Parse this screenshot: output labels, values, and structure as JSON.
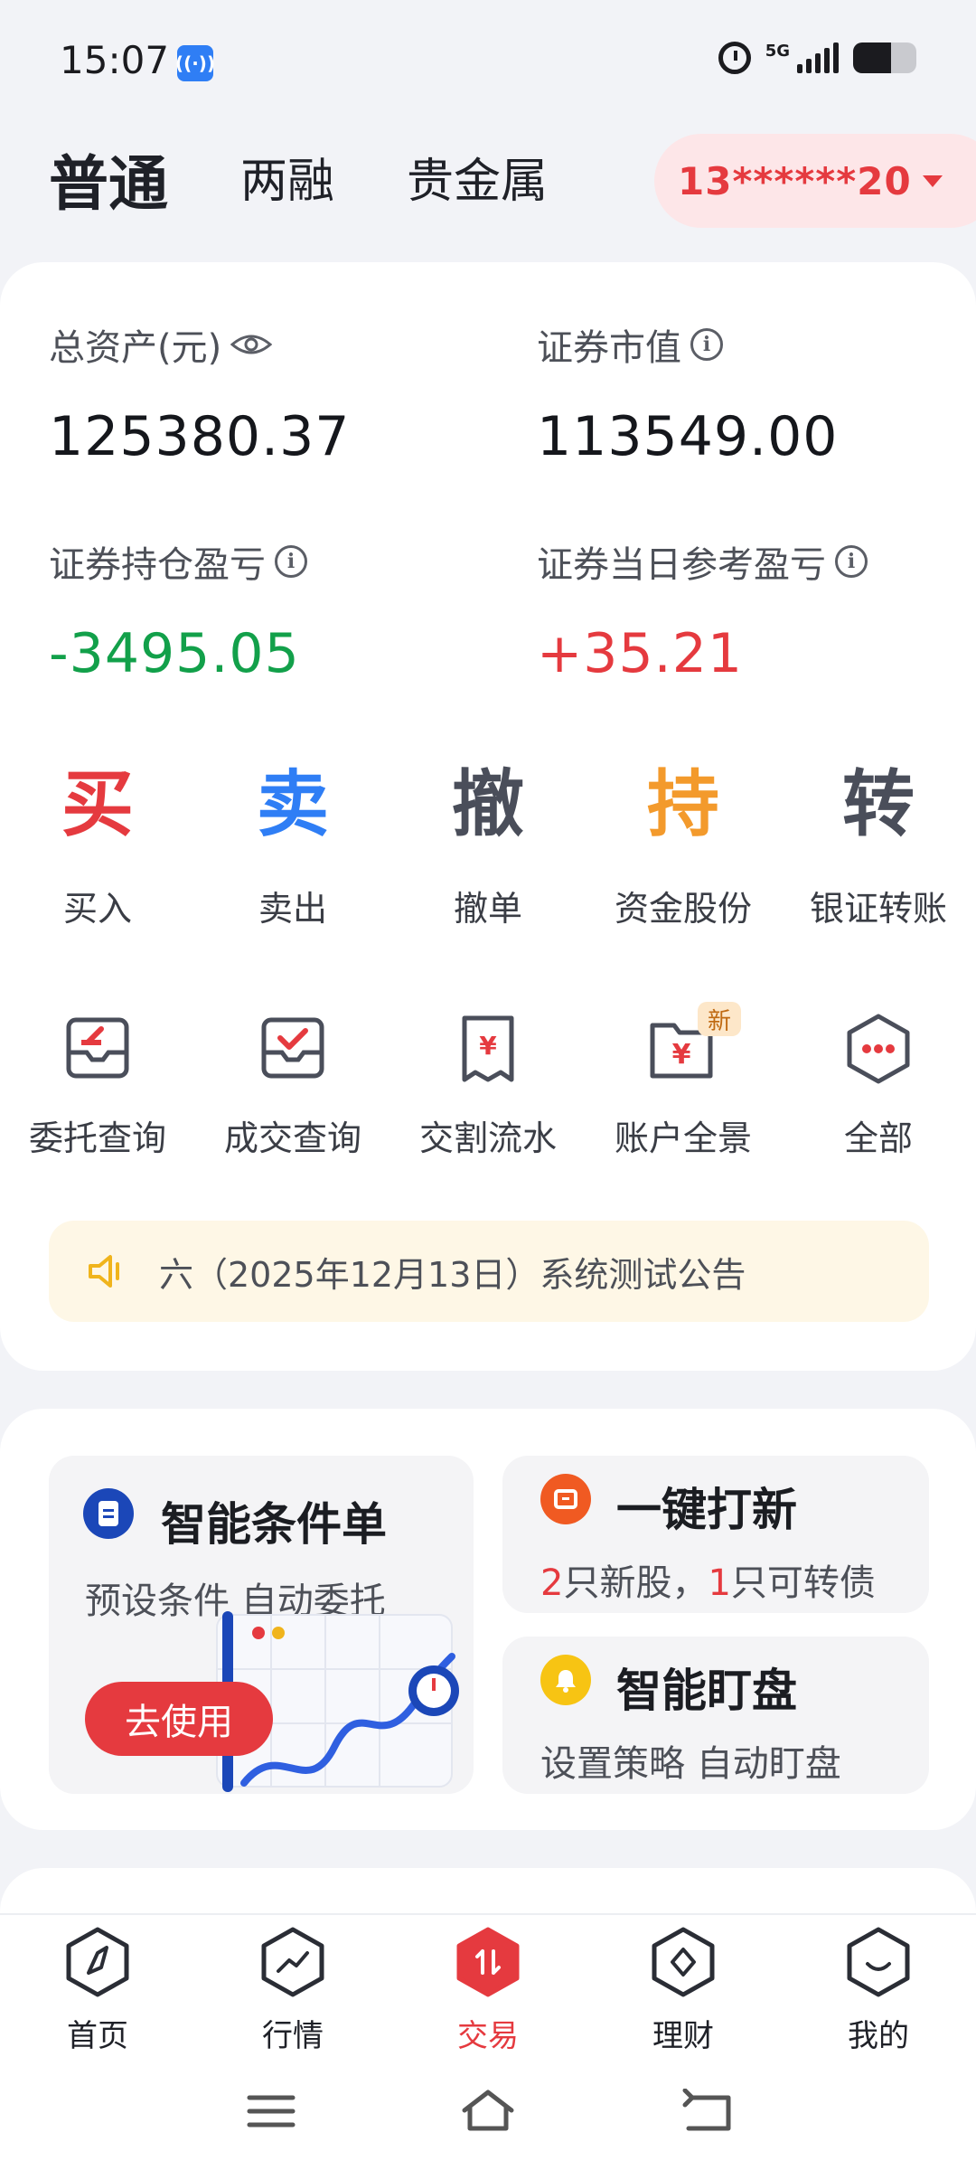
{
  "status_bar": {
    "time": "15:07",
    "network": "5G"
  },
  "tabs": [
    {
      "label": "普通",
      "active": true
    },
    {
      "label": "两融",
      "active": false
    },
    {
      "label": "贵金属",
      "active": false
    }
  ],
  "account": {
    "id": "13******20"
  },
  "assets": {
    "total_label": "总资产(元)",
    "total_value": "125380.37",
    "market_label": "证券市值",
    "market_value": "113549.00",
    "position_pl_label": "证券持仓盈亏",
    "position_pl_value": "-3495.05",
    "daily_pl_label": "证券当日参考盈亏",
    "daily_pl_value": "+35.21"
  },
  "quick_actions": [
    {
      "glyph": "买",
      "label": "买入",
      "color": "#e53a3f"
    },
    {
      "glyph": "卖",
      "label": "卖出",
      "color": "#2f7ef5"
    },
    {
      "glyph": "撤",
      "label": "撤单",
      "color": "#4a4e5a"
    },
    {
      "glyph": "持",
      "label": "资金股份",
      "color": "#f39a2c"
    },
    {
      "glyph": "转",
      "label": "银证转账",
      "color": "#4a4e5a"
    }
  ],
  "tools": [
    {
      "label": "委托查询",
      "icon": "entrust-query-icon"
    },
    {
      "label": "成交查询",
      "icon": "deal-query-icon"
    },
    {
      "label": "交割流水",
      "icon": "settlement-icon"
    },
    {
      "label": "账户全景",
      "icon": "account-overview-icon",
      "badge": "新"
    },
    {
      "label": "全部",
      "icon": "more-icon"
    }
  ],
  "notice": {
    "text": "六（2025年12月13日）系统测试公告"
  },
  "features": {
    "smart_order": {
      "title": "智能条件单",
      "subtitle": "预设条件 自动委托",
      "button": "去使用"
    },
    "ipo": {
      "title": "一键打新",
      "count_stocks": "2",
      "stocks_text": "只新股，",
      "count_bonds": "1",
      "bonds_text": "只可转债"
    },
    "monitor": {
      "title": "智能盯盘",
      "subtitle": "设置策略 自动盯盘"
    }
  },
  "bottom_nav": [
    {
      "label": "首页",
      "active": false
    },
    {
      "label": "行情",
      "active": false
    },
    {
      "label": "交易",
      "active": true
    },
    {
      "label": "理财",
      "active": false
    },
    {
      "label": "我的",
      "active": false
    }
  ],
  "colors": {
    "accent_red": "#e53a3f",
    "gain_green": "#12a04a",
    "blue": "#2f7ef5",
    "orange": "#f39a2c"
  }
}
